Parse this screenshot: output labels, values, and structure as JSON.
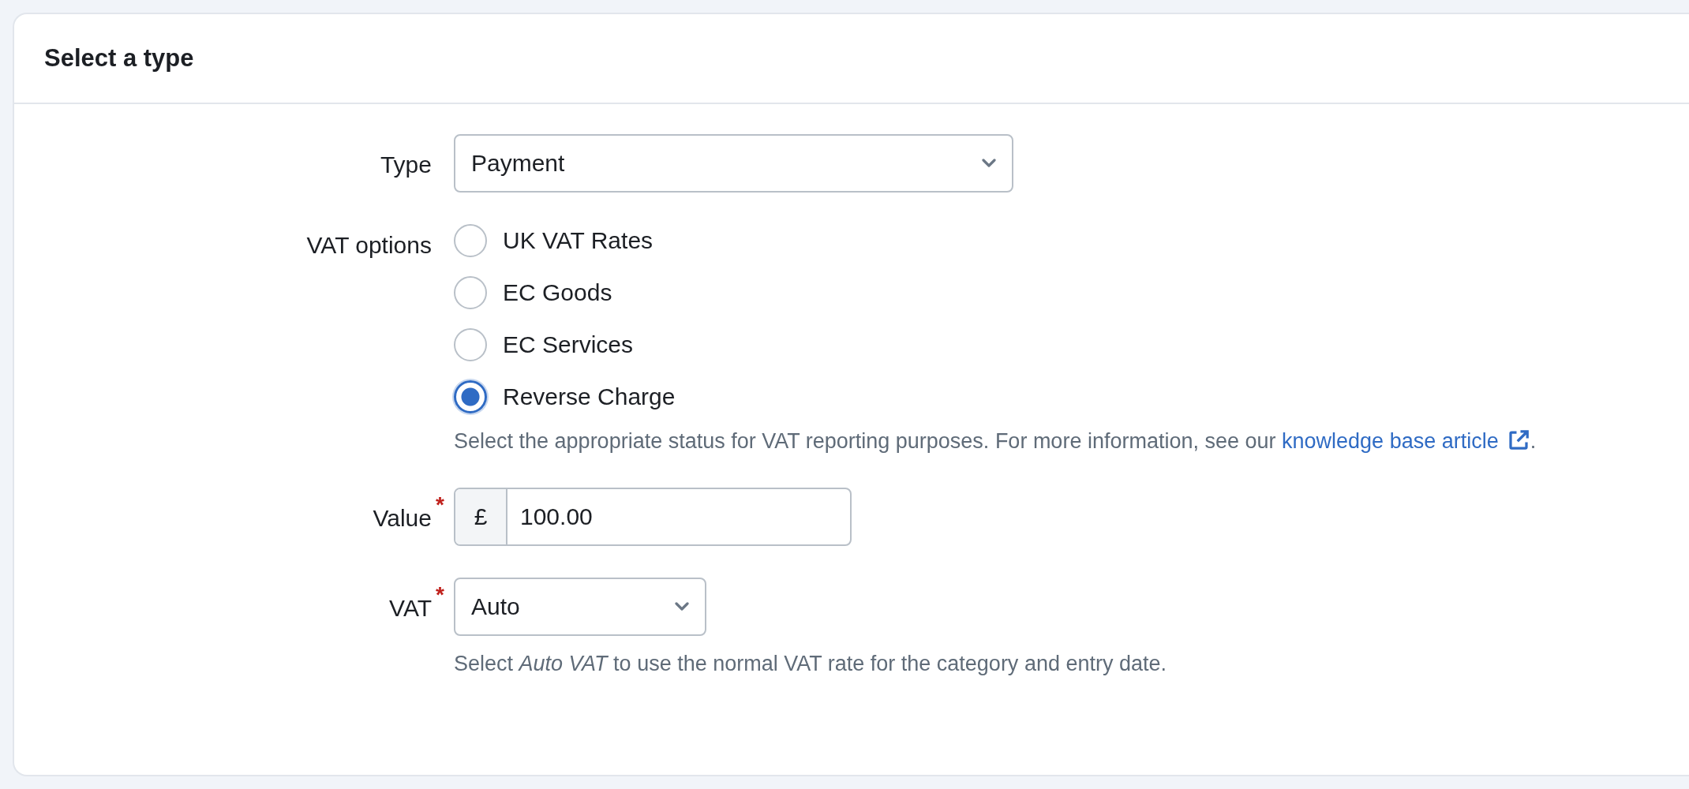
{
  "card": {
    "title": "Select a type"
  },
  "fields": [
    {
      "kind": "select",
      "label": "Type",
      "value": "Payment"
    },
    {
      "kind": "radio",
      "label": "VAT options",
      "options": [
        {
          "label": "UK VAT Rates",
          "selected": false
        },
        {
          "label": "EC Goods",
          "selected": false
        },
        {
          "label": "EC Services",
          "selected": false
        },
        {
          "label": "Reverse Charge",
          "selected": true
        }
      ],
      "help": {
        "before": "Select the appropriate status for VAT reporting purposes. For more information, see our ",
        "link": "knowledge base article",
        "after": "."
      }
    },
    {
      "kind": "money",
      "label": "Value",
      "required_mark": "*",
      "prefix": "£",
      "value": "100.00"
    },
    {
      "kind": "select",
      "label": "VAT",
      "required_mark": "*",
      "value": "Auto",
      "help_text": "Select *Auto VAT* to use the normal VAT rate for the category and entry date."
    }
  ]
}
